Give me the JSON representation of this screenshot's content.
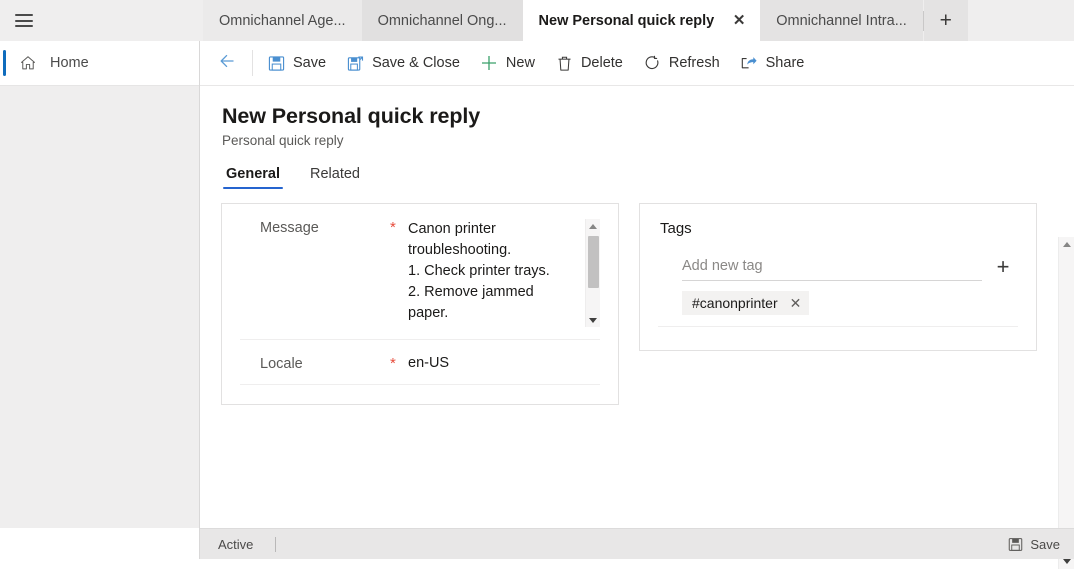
{
  "colors": {
    "accent_blue": "#0f6cbd",
    "tab_underline": "#2564cf",
    "required_red": "#e74c3c",
    "new_green": "#3aa06a",
    "icon_blue": "#4a8fd0",
    "chrome_gray": "#efeeee",
    "status_gray": "#e8e7e7"
  },
  "tabstrip": {
    "hamburger_icon": "hamburger-icon",
    "new_tab_icon": "plus-icon",
    "tabs": [
      {
        "label": "Omnichannel Age...",
        "active": false
      },
      {
        "label": "Omnichannel Ong...",
        "active": false
      },
      {
        "label": "New Personal quick reply",
        "active": true,
        "close_icon": "close-icon"
      },
      {
        "label": "Omnichannel Intra...",
        "active": false
      }
    ]
  },
  "leftnav": {
    "home": {
      "label": "Home",
      "icon": "home-icon"
    }
  },
  "commandbar": {
    "back_icon": "back-arrow-icon",
    "buttons": [
      {
        "label": "Save",
        "icon": "save-icon"
      },
      {
        "label": "Save & Close",
        "icon": "save-and-close-icon"
      },
      {
        "label": "New",
        "icon": "plus-icon"
      },
      {
        "label": "Delete",
        "icon": "trash-icon"
      },
      {
        "label": "Refresh",
        "icon": "refresh-icon"
      },
      {
        "label": "Share",
        "icon": "share-icon"
      }
    ]
  },
  "form": {
    "title": "New Personal quick reply",
    "subtitle": "Personal quick reply",
    "tabs": [
      {
        "label": "General",
        "active": true
      },
      {
        "label": "Related",
        "active": false
      }
    ],
    "fields": {
      "message": {
        "label": "Message",
        "required_marker": "*",
        "lines": [
          "Canon printer",
          "troubleshooting.",
          "1. Check printer trays.",
          "2. Remove jammed",
          "paper."
        ],
        "scroll_up_icon": "chevron-up-icon",
        "scroll_down_icon": "chevron-down-icon"
      },
      "locale": {
        "label": "Locale",
        "required_marker": "*",
        "value": "en-US"
      }
    },
    "tags": {
      "title": "Tags",
      "input_placeholder": "Add new tag",
      "input_value": "",
      "add_icon": "plus-icon",
      "chips": [
        {
          "label": "#canonprinter",
          "remove_icon": "close-icon"
        }
      ]
    }
  },
  "page_scrollbar": {
    "up_icon": "chevron-up-icon",
    "down_icon": "chevron-down-icon"
  },
  "statusbar": {
    "state": "Active",
    "save_label": "Save",
    "save_icon": "save-icon"
  }
}
